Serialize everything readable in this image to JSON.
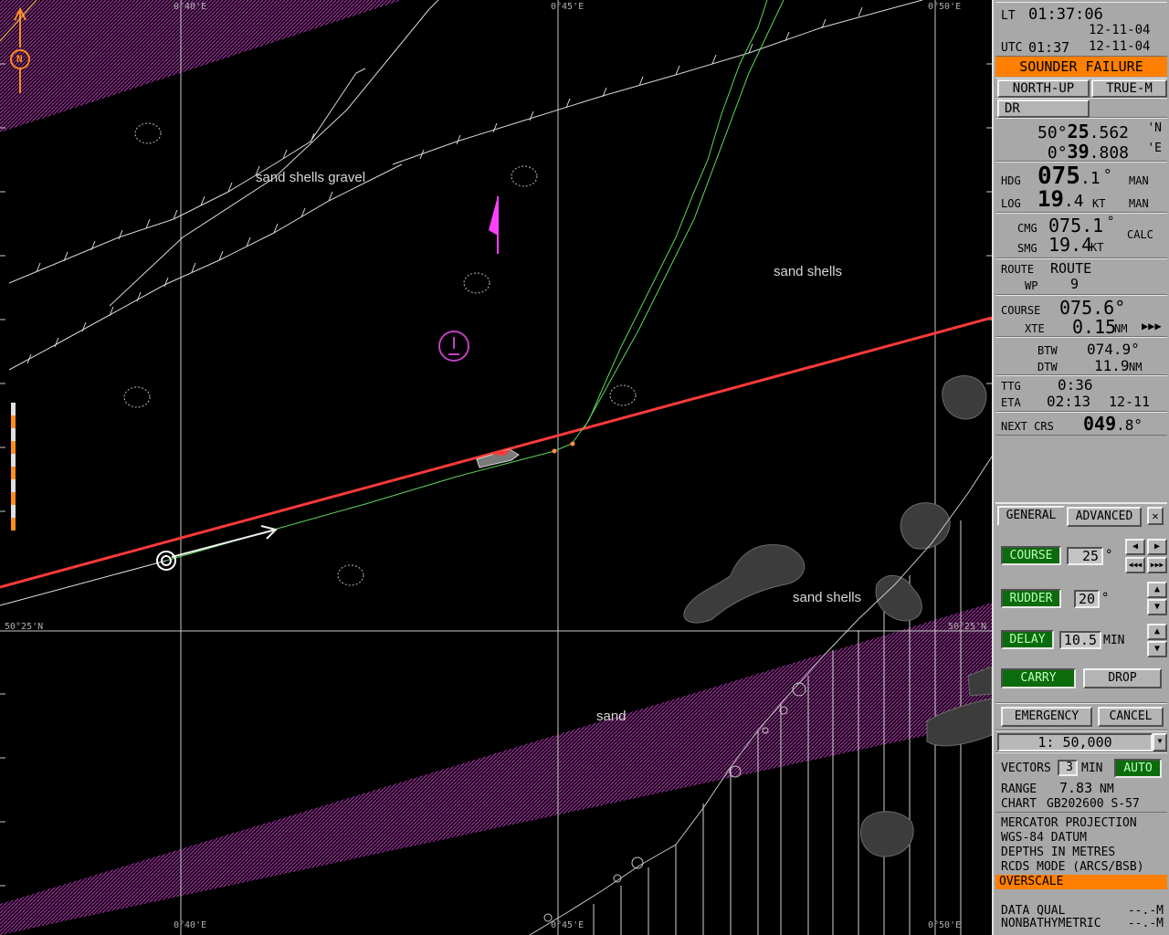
{
  "chart": {
    "lon_top": [
      "0°40'E",
      "0°45'E",
      "0°50'E"
    ],
    "lon_bottom": [
      "0°40'E",
      "0°45'E",
      "0°50'E"
    ],
    "lat_left": "50°25'N",
    "lat_right": "50°25'N",
    "labels": [
      "sand shells gravel",
      "sand shells",
      "sand shells",
      "sand"
    ],
    "north": "N",
    "colors": {
      "route": "#ff3a3a",
      "track": "#5cd65c",
      "restricted": "#8a2a8a",
      "obstruction": "#3c3c3c",
      "coast": "#c8c8c8"
    }
  },
  "panel": {
    "lt_label": "LT",
    "lt_time": "01:37:06",
    "lt_date": "12-11-04",
    "utc_label": "UTC",
    "utc_time": "01:37",
    "utc_date": "12-11-04",
    "alarm": "SOUNDER FAILURE",
    "orientation": "NORTH-UP",
    "motion": "TRUE-M",
    "pos_mode": "DR",
    "lat_deg": "50°",
    "lat_min": "25",
    "lat_frac": ".562",
    "lat_hem": "'N",
    "lon_deg": "0°",
    "lon_min": "39",
    "lon_frac": ".808",
    "lon_hem": "'E",
    "hdg_label": "HDG",
    "hdg_val": "075",
    "hdg_frac": ".1",
    "hdg_unit": "°",
    "hdg_src": "MAN",
    "log_label": "LOG",
    "log_val": "19",
    "log_frac": ".4",
    "log_unit": "KT",
    "log_src": "MAN",
    "cmg_label": "CMG",
    "cmg_val": "075.1",
    "cmg_unit": "°",
    "smg_label": "SMG",
    "smg_val": "19.4",
    "smg_unit": "KT",
    "calc": "CALC",
    "route_label": "ROUTE",
    "route_name": "ROUTE",
    "wp_label": "WP",
    "wp_val": "9",
    "course_label": "COURSE",
    "course_val": "075.6°",
    "xte_label": "XTE",
    "xte_val": "0.15",
    "xte_unit": "NM",
    "xte_arrows": "▶▶▶",
    "btw_label": "BTW",
    "btw_val": "074.9°",
    "dtw_label": "DTW",
    "dtw_val": "11.9",
    "dtw_unit": "NM",
    "ttg_label": "TTG",
    "ttg_val": "0:36",
    "eta_label": "ETA",
    "eta_time": "02:13",
    "eta_date": "12-11",
    "next_label": "NEXT CRS",
    "next_val": "049",
    "next_frac": ".8°",
    "tab_general": "GENERAL",
    "tab_advanced": "ADVANCED",
    "close": "✕",
    "course_btn": "COURSE",
    "course_input": "25",
    "course_unit": "°",
    "rudder_btn": "RUDDER",
    "rudder_input": "20",
    "rudder_unit": "°",
    "delay_btn": "DELAY",
    "delay_input": "10.5",
    "delay_unit": "MIN",
    "carry": "CARRY",
    "drop": "DROP",
    "emergency": "EMERGENCY",
    "cancel": "CANCEL",
    "scale": "1: 50,000",
    "vectors_label": "VECTORS",
    "vectors_val": "3",
    "vectors_unit": "MIN",
    "auto": "AUTO",
    "range_label": "RANGE",
    "range_val": "7.83",
    "range_unit": "NM",
    "chart_label": "CHART",
    "chart_val": "GB202600 S-57",
    "proj": "MERCATOR PROJECTION",
    "datum": "WGS-84 DATUM",
    "depths": "DEPTHS IN METRES",
    "rcds": "RCDS MODE (ARCS/BSB)",
    "overscale": "OVERSCALE",
    "dq_label": "DATA QUAL",
    "dq_val": "--.-M",
    "nb_label": "NONBATHYMETRIC",
    "nb_val": "--.-M"
  }
}
